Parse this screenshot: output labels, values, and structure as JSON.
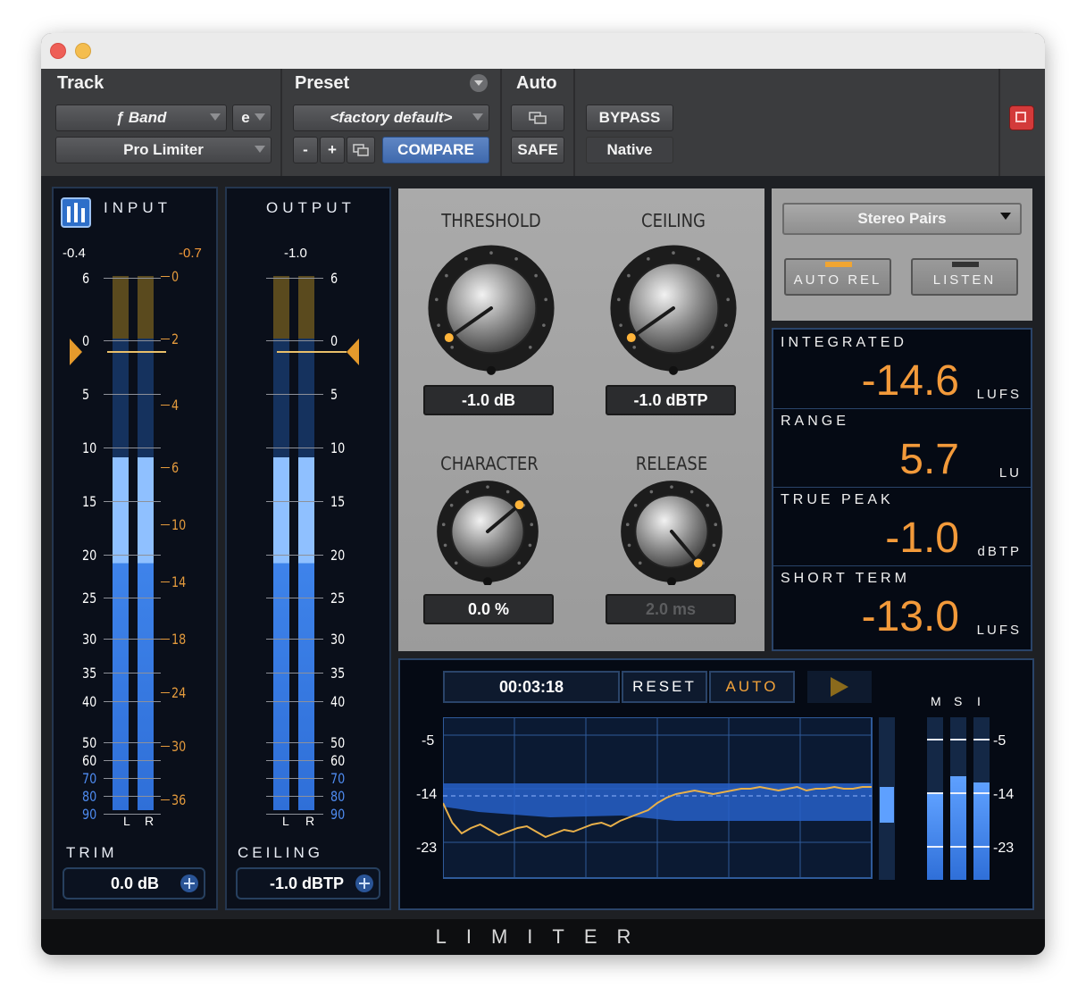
{
  "header": {
    "track_label": "Track",
    "preset_label": "Preset",
    "auto_label": "Auto",
    "band_select": "ƒ Band",
    "e_select": "e",
    "plugin_select": "Pro Limiter",
    "preset_select": "<factory default>",
    "minus": "-",
    "plus": "+",
    "compare": "COMPARE",
    "safe": "SAFE",
    "bypass": "BYPASS",
    "native": "Native"
  },
  "input_meter": {
    "title": "INPUT",
    "peak_left": "-0.4",
    "peak_right": "-0.7",
    "scale": [
      "6",
      "0",
      "5",
      "10",
      "15",
      "20",
      "25",
      "30",
      "35",
      "40",
      "50",
      "60",
      "70",
      "80",
      "90"
    ],
    "gr_scale": [
      "0",
      "2",
      "4",
      "6",
      "10",
      "14",
      "18",
      "24",
      "30",
      "36"
    ],
    "channels": [
      "L",
      "R"
    ],
    "trim_label": "TRIM",
    "trim_value": "0.0 dB",
    "level_fraction": 0.66
  },
  "output_meter": {
    "title": "OUTPUT",
    "peak": "-1.0",
    "scale": [
      "6",
      "0",
      "5",
      "10",
      "15",
      "20",
      "25",
      "30",
      "35",
      "40",
      "50",
      "60",
      "70",
      "80",
      "90"
    ],
    "channels": [
      "L",
      "R"
    ],
    "ceiling_label": "CEILING",
    "ceiling_value": "-1.0 dBTP",
    "level_fraction": 0.66
  },
  "knobs": {
    "threshold": {
      "label": "THRESHOLD",
      "value": "-1.0 dB"
    },
    "ceiling": {
      "label": "CEILING",
      "value": "-1.0 dBTP"
    },
    "character": {
      "label": "CHARACTER",
      "value": "0.0 %"
    },
    "release": {
      "label": "RELEASE",
      "value": "2.0 ms"
    }
  },
  "mode": {
    "select": "Stereo Pairs",
    "auto_rel": "AUTO REL",
    "listen": "LISTEN"
  },
  "loudness": {
    "integrated": {
      "label": "INTEGRATED",
      "value": "-14.6",
      "unit": "LUFS"
    },
    "range": {
      "label": "RANGE",
      "value": "5.7",
      "unit": "LU"
    },
    "true_peak": {
      "label": "TRUE PEAK",
      "value": "-1.0",
      "unit": "dBTP"
    },
    "short_term": {
      "label": "SHORT TERM",
      "value": "-13.0",
      "unit": "LUFS"
    }
  },
  "history": {
    "time": "00:03:18",
    "reset": "RESET",
    "auto": "AUTO",
    "y_labels": [
      "-5",
      "-14",
      "-23"
    ],
    "msi_labels": [
      "M",
      "S",
      "I"
    ],
    "msi_levels": [
      0.53,
      0.64,
      0.6
    ],
    "msi_scale": [
      "-5",
      "-14",
      "-23"
    ]
  },
  "footer": {
    "title": "LIMITER"
  },
  "colors": {
    "accent_orange": "#f39a3a",
    "meter_blue": "#4b8ff0",
    "compare_blue": "#4a74b8"
  }
}
